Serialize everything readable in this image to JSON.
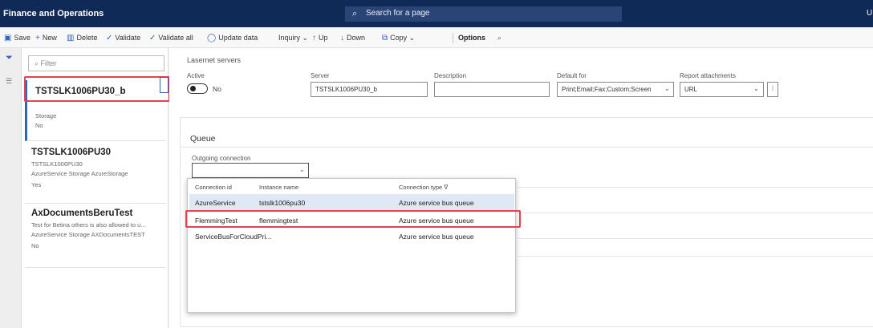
{
  "app": {
    "title": "Finance and Operations",
    "search_placeholder": "Search for a page",
    "user_initial": "U"
  },
  "actions": {
    "save": "Save",
    "new": "New",
    "delete": "Delete",
    "validate": "Validate",
    "validate_all": "Validate all",
    "update_data": "Update data",
    "inquiry": "Inquiry",
    "up": "Up",
    "down": "Down",
    "copy": "Copy",
    "options": "Options"
  },
  "list": {
    "filter_placeholder": "Filter",
    "items": [
      {
        "title": "TSTSLK1006PU30_b",
        "line1": "Storage",
        "line2": "No"
      },
      {
        "title": "TSTSLK1006PU30",
        "line1": "TSTSLK1006PU30",
        "line2": "AzureService Storage AzureStorage",
        "line3": "Yes"
      },
      {
        "title": "AxDocumentsBeruTest",
        "line1": "Test for Betina others is also allowed to u...",
        "line2": "AzureService Storage AXDocumentsTEST",
        "line3": "No"
      }
    ]
  },
  "header": {
    "section": "Lasernet servers",
    "active_label": "Active",
    "active_value": "No",
    "server_label": "Server",
    "server_value": "TSTSLK1006PU30_b",
    "description_label": "Description",
    "description_value": "",
    "default_for_label": "Default for",
    "default_for_value": "Print;Email;Fax;Custom;Screen",
    "report_attachments_label": "Report attachments",
    "report_attachments_value": "URL"
  },
  "queue": {
    "title": "Queue",
    "outgoing_label": "Outgoing connection",
    "outgoing_value": "",
    "lookup": {
      "columns": [
        "Connection id",
        "Instance name",
        "Connection type"
      ],
      "rows": [
        {
          "id": "AzureService",
          "instance": "tstslk1006pu30",
          "type": "Azure service bus queue"
        },
        {
          "id": "FlemmingTest",
          "instance": "flemmingtest",
          "type": "Azure service bus queue"
        },
        {
          "id": "ServiceBusForCloudPri...",
          "instance": "",
          "type": "Azure service bus queue"
        }
      ]
    }
  },
  "colors": {
    "topbar": "#0f2a56",
    "accent": "#2f66b3",
    "highlight": "#e0444e",
    "selected_row": "#dfe8f5"
  }
}
